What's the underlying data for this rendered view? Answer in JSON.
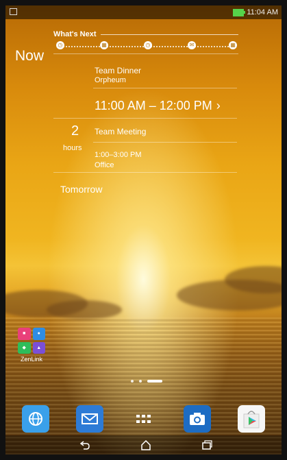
{
  "status_bar": {
    "time": "11:04 AM",
    "colors": {
      "battery": "#56d34b"
    }
  },
  "widget": {
    "title": "What's Next",
    "timeline_icons": [
      "clock-icon",
      "calendar-icon",
      "clock-icon",
      "mail-icon",
      "calendar-icon"
    ],
    "now_label": "Now",
    "event1": {
      "title": "Team Dinner",
      "location": "Orpheum",
      "time": "11:00 AM – 12:00 PM"
    },
    "countdown": {
      "number": "2",
      "unit": "hours"
    },
    "event2": {
      "title": "Team Meeting",
      "time": "1:00–3:00 PM",
      "location": "Office"
    },
    "tomorrow_label": "Tomorrow"
  },
  "folder": {
    "label": "ZenLink"
  },
  "dock": {
    "items": [
      {
        "name": "browser",
        "icon": "globe-icon"
      },
      {
        "name": "mail",
        "icon": "envelope-icon"
      },
      {
        "name": "all-apps",
        "icon": "grid-icon"
      },
      {
        "name": "camera",
        "icon": "camera-icon"
      },
      {
        "name": "play-store",
        "icon": "shopping-bag-icon"
      }
    ]
  },
  "nav_bar": {
    "buttons": [
      "back-icon",
      "home-icon",
      "recent-apps-icon"
    ]
  }
}
